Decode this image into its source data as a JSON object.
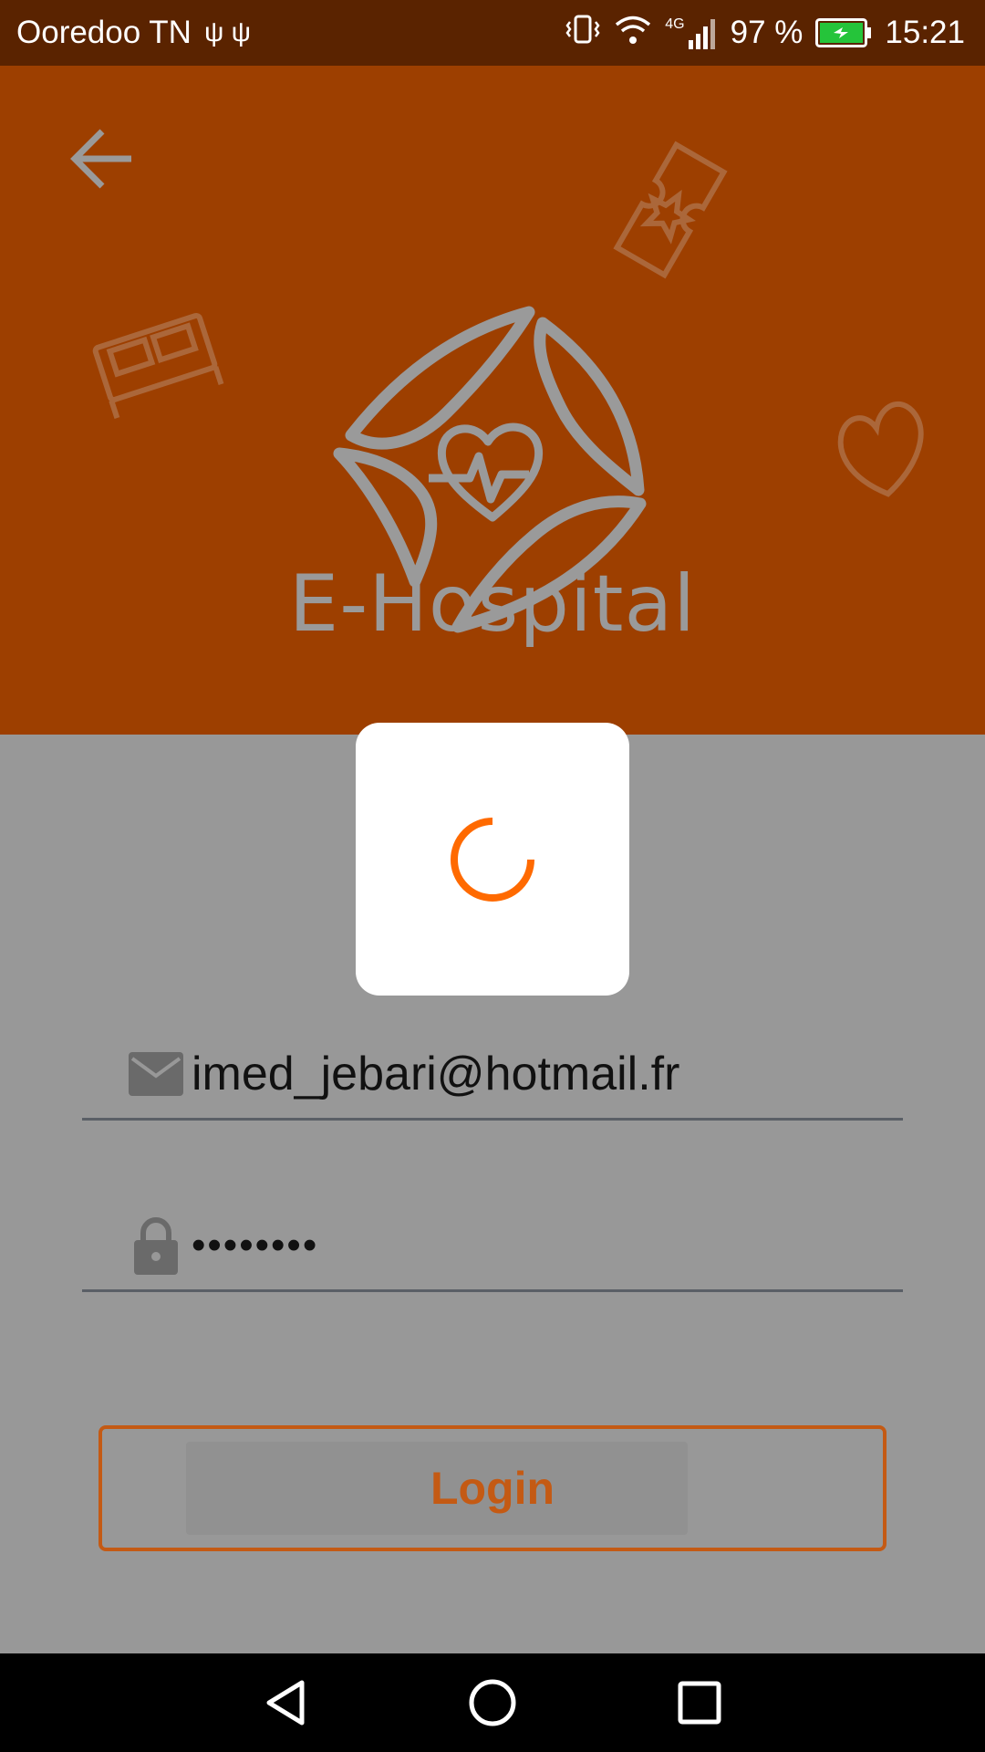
{
  "status_bar": {
    "carrier": "Ooredoo TN",
    "usb_icons": "ψ ψ",
    "network": "4G",
    "battery_percent": "97 %",
    "time": "15:21",
    "battery_color": "#25c43a"
  },
  "header": {
    "app_name": "E-Hospital",
    "background_color": "#9d3f00"
  },
  "form": {
    "email_value": "imed_jebari@hotmail.fr",
    "password_value": "••••••••",
    "login_label": "Login",
    "accent_color": "#c45a14"
  },
  "dialog": {
    "spinner_color": "#ff6a00"
  },
  "icons": {
    "back": "arrow-back-icon",
    "email": "email-icon",
    "password": "lock-icon",
    "nav_back": "nav-back-icon",
    "nav_home": "nav-home-icon",
    "nav_recents": "nav-recents-icon"
  }
}
